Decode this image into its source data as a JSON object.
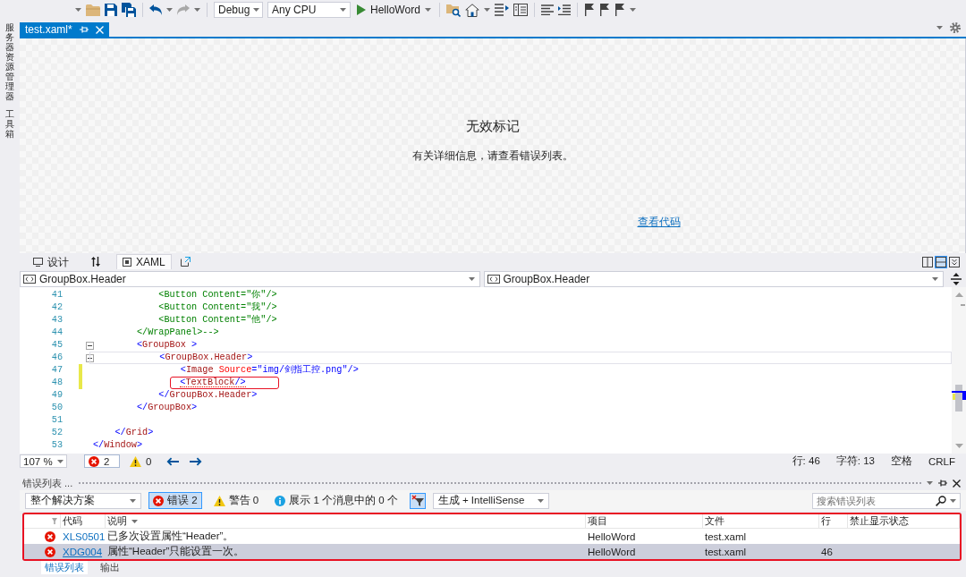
{
  "toolbar": {
    "configuration": "Debug",
    "platform": "Any CPU",
    "start_target": "HelloWord",
    "redo": {
      "disabled": true
    }
  },
  "sidebar": {
    "items": [
      {
        "label": "服务器资源管理器"
      },
      {
        "label": "工具箱"
      }
    ]
  },
  "document_tabs": [
    {
      "title": "test.xaml*",
      "selected": true
    }
  ],
  "designer": {
    "title": "无效标记",
    "message": "有关详细信息，请查看错误列表。",
    "link": "查看代码"
  },
  "view_bar": {
    "tabs": [
      {
        "label": "设计",
        "selected": false
      },
      {
        "label": "XAML",
        "selected": true
      }
    ],
    "layout_buttons": [
      {
        "selected": false
      },
      {
        "selected": true
      },
      {
        "selected": false
      }
    ]
  },
  "editor": {
    "navigation": [
      "GroupBox.Header",
      "GroupBox.Header"
    ],
    "lines": [
      {
        "number": "41",
        "tokens": [
          {
            "kind": "comment",
            "text": "            <Button Content=\"你\"/>"
          }
        ],
        "changed": false,
        "foldable": false,
        "current": false,
        "annotated": false,
        "error": false
      },
      {
        "number": "42",
        "tokens": [
          {
            "kind": "comment",
            "text": "            <Button Content=\"我\"/>"
          }
        ],
        "changed": false,
        "foldable": false,
        "current": false,
        "annotated": false,
        "error": false
      },
      {
        "number": "43",
        "tokens": [
          {
            "kind": "comment",
            "text": "            <Button Content=\"他\"/>"
          }
        ],
        "changed": false,
        "foldable": false,
        "current": false,
        "annotated": false,
        "error": false
      },
      {
        "number": "44",
        "tokens": [
          {
            "kind": "comment",
            "text": "        </WrapPanel>-->"
          }
        ],
        "changed": false,
        "foldable": false,
        "current": false,
        "annotated": false,
        "error": false
      },
      {
        "number": "45",
        "tokens": [
          {
            "kind": "bracket",
            "text": "        <"
          },
          {
            "kind": "element",
            "text": "GroupBox"
          },
          {
            "kind": "bracket",
            "text": " >"
          }
        ],
        "changed": false,
        "foldable": true,
        "current": false,
        "annotated": false,
        "error": false
      },
      {
        "number": "46",
        "tokens": [
          {
            "kind": "bracket",
            "text": "            <"
          },
          {
            "kind": "element",
            "text": "GroupBox.Header"
          },
          {
            "kind": "bracket",
            "text": ">"
          }
        ],
        "changed": false,
        "foldable": true,
        "current": true,
        "annotated": false,
        "error": false
      },
      {
        "number": "47",
        "tokens": [
          {
            "kind": "bracket",
            "text": "                <"
          },
          {
            "kind": "element",
            "text": "Image"
          },
          {
            "kind": "attribute",
            "text": " Source"
          },
          {
            "kind": "value",
            "text": "=\"img/剑指工控.png\""
          },
          {
            "kind": "bracket",
            "text": "/>"
          }
        ],
        "changed": true,
        "foldable": false,
        "current": false,
        "annotated": false,
        "error": false
      },
      {
        "number": "48",
        "tokens": [
          {
            "kind": "bracket",
            "text": "                <"
          },
          {
            "kind": "element",
            "text": "TextBlock"
          },
          {
            "kind": "bracket",
            "text": "/>"
          }
        ],
        "changed": true,
        "foldable": false,
        "current": false,
        "annotated": true,
        "error": true
      },
      {
        "number": "49",
        "tokens": [
          {
            "kind": "bracket",
            "text": "            </"
          },
          {
            "kind": "element",
            "text": "GroupBox.Header"
          },
          {
            "kind": "bracket",
            "text": ">"
          }
        ],
        "changed": false,
        "foldable": false,
        "current": false,
        "annotated": false,
        "error": false
      },
      {
        "number": "50",
        "tokens": [
          {
            "kind": "bracket",
            "text": "        </"
          },
          {
            "kind": "element",
            "text": "GroupBox"
          },
          {
            "kind": "bracket",
            "text": ">"
          }
        ],
        "changed": false,
        "foldable": false,
        "current": false,
        "annotated": false,
        "error": false
      },
      {
        "number": "51",
        "changed": false,
        "foldable": false,
        "current": false,
        "annotated": false,
        "error": false
      },
      {
        "number": "52",
        "tokens": [
          {
            "kind": "bracket",
            "text": "    </"
          },
          {
            "kind": "element",
            "text": "Grid"
          },
          {
            "kind": "bracket",
            "text": ">"
          }
        ],
        "changed": false,
        "foldable": false,
        "current": false,
        "annotated": false,
        "error": false
      },
      {
        "number": "53",
        "tokens": [
          {
            "kind": "bracket",
            "text": "</"
          },
          {
            "kind": "element",
            "text": "Window"
          },
          {
            "kind": "bracket",
            "text": ">"
          }
        ],
        "changed": false,
        "foldable": false,
        "current": false,
        "annotated": false,
        "error": false
      }
    ],
    "status": {
      "zoom": "107 %",
      "errors": {
        "count": "2",
        "selected": true
      },
      "warnings": {
        "count": "0"
      },
      "line": "行: 46",
      "column": "字符: 13",
      "indent_mode": "空格",
      "line_ending": "CRLF"
    }
  },
  "error_list": {
    "title": "错误列表 ...",
    "scope": "整个解决方案",
    "filters": [
      {
        "kind": "error",
        "label": "错误 2",
        "selected": true
      },
      {
        "kind": "warning",
        "label": "警告 0",
        "selected": false
      },
      {
        "kind": "message",
        "label": "展示 1 个消息中的 0 个",
        "selected": false
      }
    ],
    "filter_toggle": {
      "on": true
    },
    "source": "生成 + IntelliSense",
    "search": {
      "placeholder": "搜索错误列表"
    },
    "table": {
      "annotated": true,
      "columns": [
        {
          "label": "代码",
          "sorted": false
        },
        {
          "label": "说明",
          "sorted": true
        },
        {
          "label": "项目",
          "sorted": false
        },
        {
          "label": "文件",
          "sorted": false
        },
        {
          "label": "行",
          "sorted": false
        },
        {
          "label": "禁止显示状态",
          "sorted": false
        }
      ],
      "rows": [
        {
          "kind": "error",
          "code": "XLS0501",
          "description": "已多次设置属性“Header”。",
          "project": "HelloWord",
          "file": "test.xaml",
          "selected": false
        },
        {
          "kind": "error",
          "code": "XDG004",
          "description": "属性“Header”只能设置一次。",
          "project": "HelloWord",
          "file": "test.xaml",
          "line": "46",
          "selected": true
        }
      ]
    }
  },
  "bottom_tabs": [
    {
      "label": "错误列表",
      "selected": true
    },
    {
      "label": "输出",
      "selected": false
    }
  ]
}
